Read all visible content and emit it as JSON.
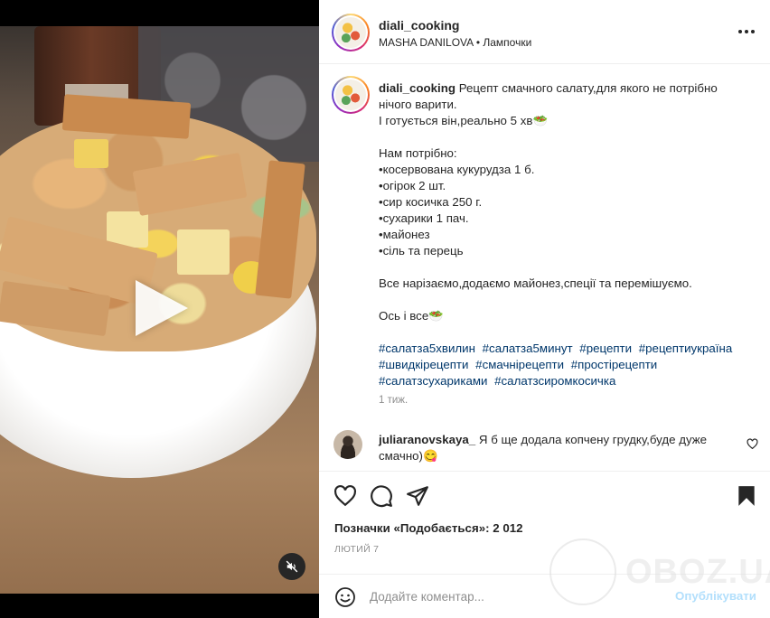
{
  "post": {
    "username": "diali_cooking",
    "audio_artist": "MASHA DANILOVA",
    "separator": "•",
    "audio_track": "Лампочки",
    "caption_lines": [
      "Рецепт смачного салату,для якого не потрібно нічого варити.",
      "І готується він,реально 5 хв🥗",
      "",
      "Нам потрібно:",
      "•косервована кукурудза 1 б.",
      "•огірок 2 шт.",
      "•сир косичка 250 г.",
      "•сухарики 1 пач.",
      "•майонез",
      "•сіль та перець",
      "",
      "Все нарізаємо,додаємо майонез,спеції та перемішуємо.",
      "",
      "Ось і все🥗",
      ""
    ],
    "hashtags": [
      "#салатза5хвилин",
      "#салатза5минут",
      "#рецепти",
      "#рецептиукраїна",
      "#швидкірецепти",
      "#смачнірецепти",
      "#простірецепти",
      "#салатзсухариками",
      "#салатзсиромкосичка"
    ],
    "time_ago": "1 тиж."
  },
  "comment": {
    "username": "juliaranovskaya_",
    "text": "Я б ще додала копчену грудку,буде дуже смачно)😋"
  },
  "stats": {
    "likes_label": "Позначки «Подобається»:",
    "likes_count": "2 012",
    "date": "ЛЮТИЙ 7"
  },
  "add_comment": {
    "placeholder": "Додайте коментар...",
    "publish_label": "Опублікувати"
  },
  "watermark": "OBOZ.UA",
  "colors": {
    "link": "#00376b",
    "publish_disabled": "#b2dffc",
    "muted": "#8e8e8e"
  }
}
